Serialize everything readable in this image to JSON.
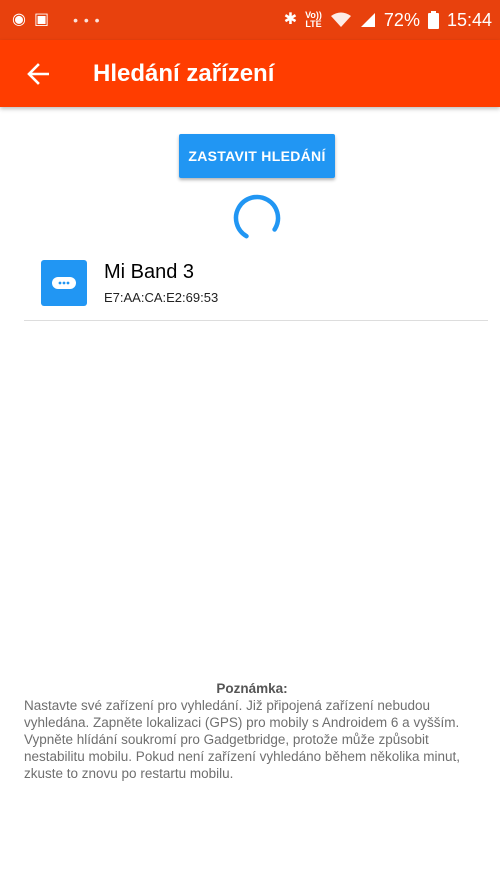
{
  "status_bar": {
    "lte_line1": "Vo))",
    "lte_line2": "LTE",
    "battery": "72%",
    "time": "15:44"
  },
  "app_bar": {
    "title": "Hledání zařízení",
    "back_icon": "arrow-left-icon"
  },
  "scan_button": {
    "label": "ZASTAVIT HLEDÁNÍ"
  },
  "devices": [
    {
      "name": "Mi Band 3",
      "address": "E7:AA:CA:E2:69:53",
      "icon": "device-icon"
    }
  ],
  "note": {
    "title": "Poznámka:",
    "text": "Nastavte své zařízení pro vyhledání. Již připojená zařízení nebudou vyhledána. Zapněte lokalizaci (GPS) pro mobily s Androidem 6 a vyšším. Vypněte hlídání soukromí pro Gadgetbridge, protože může způsobit nestabilitu mobilu. Pokud není zařízení vyhledáno během několika minut, zkuste to znovu po restartu mobilu."
  },
  "colors": {
    "status_bar": "#e8410d",
    "app_bar": "#ff3d00",
    "accent": "#2196f3"
  }
}
